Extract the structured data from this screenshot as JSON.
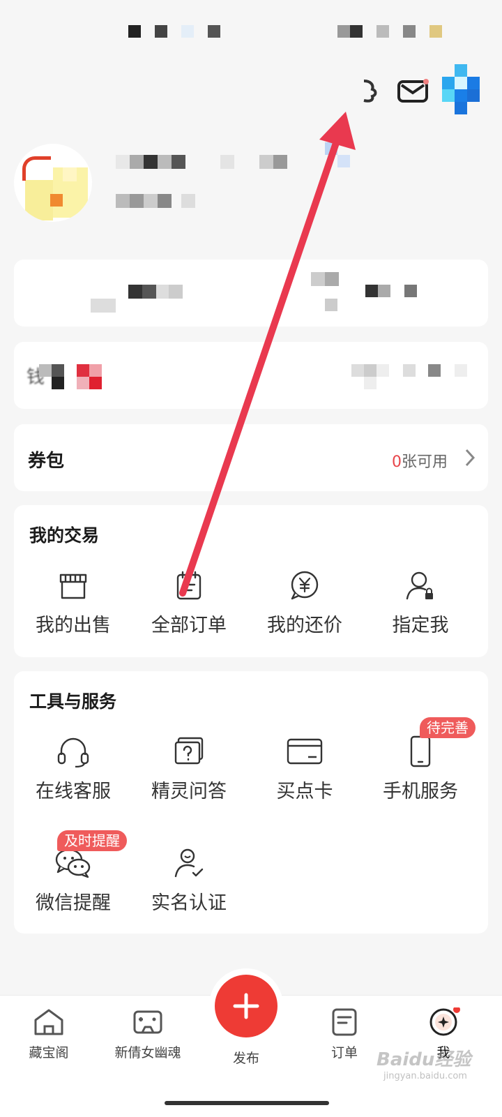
{
  "coupon": {
    "title": "券包",
    "count": "0",
    "count_suffix": "张可用"
  },
  "trade": {
    "title": "我的交易",
    "items": [
      {
        "label": "我的出售",
        "icon": "shop-icon"
      },
      {
        "label": "全部订单",
        "icon": "order-list-icon"
      },
      {
        "label": "我的还价",
        "icon": "yen-price-icon"
      },
      {
        "label": "指定我",
        "icon": "user-lock-icon"
      }
    ]
  },
  "tools": {
    "title": "工具与服务",
    "items": [
      {
        "label": "在线客服",
        "icon": "headset-icon"
      },
      {
        "label": "精灵问答",
        "icon": "question-chat-icon"
      },
      {
        "label": "买点卡",
        "icon": "card-icon"
      },
      {
        "label": "手机服务",
        "icon": "phone-icon",
        "badge": "待完善"
      },
      {
        "label": "微信提醒",
        "icon": "wechat-icon",
        "badge": "及时提醒"
      },
      {
        "label": "实名认证",
        "icon": "user-verified-icon"
      }
    ]
  },
  "wallet": {
    "label_char": "钱"
  },
  "bottom_nav": {
    "items": [
      {
        "label": "藏宝阁",
        "icon": "home-icon"
      },
      {
        "label": "新倩女幽魂",
        "icon": "gamepad-icon"
      },
      {
        "label": "发布",
        "icon": "plus-icon"
      },
      {
        "label": "订单",
        "icon": "order-icon"
      },
      {
        "label": "我",
        "icon": "me-icon"
      }
    ]
  },
  "watermark": {
    "brand": "Baidu经验",
    "url": "jingyan.baidu.com"
  },
  "colors": {
    "accent": "#e8454a",
    "arrow": "#e9394f",
    "badge": "#ef5b5b",
    "background": "#f6f6f6"
  }
}
